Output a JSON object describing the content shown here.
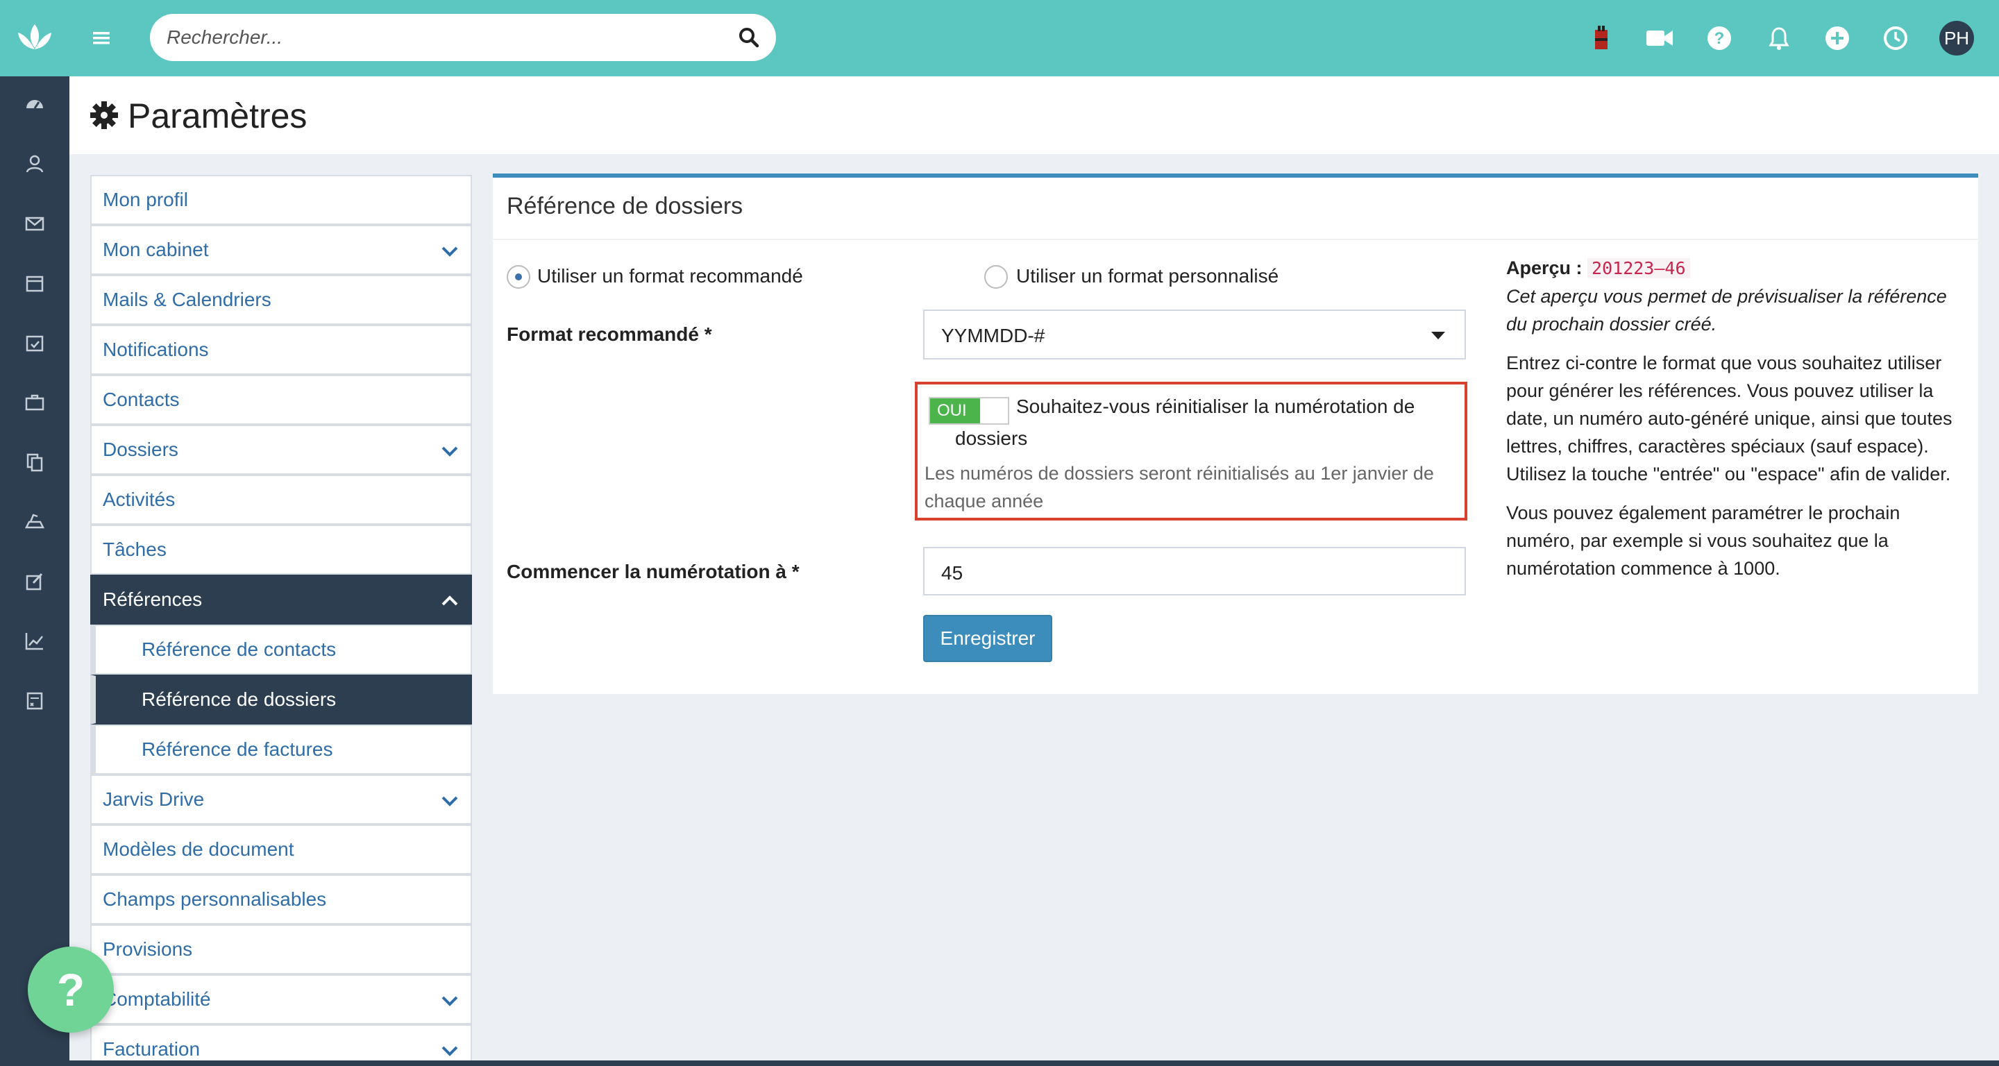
{
  "header": {
    "search_placeholder": "Rechercher...",
    "avatar_initials": "PH"
  },
  "page": {
    "title": "Paramètres"
  },
  "menu": {
    "items": [
      {
        "label": "Mon profil"
      },
      {
        "label": "Mon cabinet"
      },
      {
        "label": "Mails & Calendriers"
      },
      {
        "label": "Notifications"
      },
      {
        "label": "Contacts"
      },
      {
        "label": "Dossiers"
      },
      {
        "label": "Activités"
      },
      {
        "label": "Tâches"
      },
      {
        "label": "Références"
      },
      {
        "label": "Référence de contacts"
      },
      {
        "label": "Référence de dossiers"
      },
      {
        "label": "Référence de factures"
      },
      {
        "label": "Jarvis Drive"
      },
      {
        "label": "Modèles de document"
      },
      {
        "label": "Champs personnalisables"
      },
      {
        "label": "Provisions"
      },
      {
        "label": "Comptabilité"
      },
      {
        "label": "Facturation"
      }
    ]
  },
  "panel": {
    "title": "Référence de dossiers",
    "radio_recommended": "Utiliser un format recommandé",
    "radio_custom": "Utiliser un format personnalisé",
    "format_label": "Format recommandé *",
    "format_value": "YYMMDD-#",
    "toggle_label": "OUI",
    "reset_question_line1": "Souhaitez-vous réinitialiser la numérotation de",
    "reset_question_line2": "dossiers",
    "reset_hint": "Les numéros de dossiers seront réinitialisés au 1er janvier de chaque année",
    "start_label": "Commencer la numérotation à *",
    "start_value": "45",
    "save_label": "Enregistrer"
  },
  "preview": {
    "label": "Aperçu :",
    "code": "201223–46",
    "description": "Cet aperçu vous permet de prévisualiser la référence du prochain dossier créé.",
    "help1": "Entrez ci-contre le format que vous souhaitez utiliser pour générer les références. Vous pouvez utiliser la date, un numéro auto-généré unique, ainsi que toutes lettres, chiffres, caractères spéciaux (sauf espace).",
    "help2": "Utilisez la touche \"entrée\" ou \"espace\" afin de valider.",
    "help3": "Vous pouvez également paramétrer le prochain numéro, par exemple si vous souhaitez que la numérotation commence à 1000."
  },
  "help_fab": "?"
}
